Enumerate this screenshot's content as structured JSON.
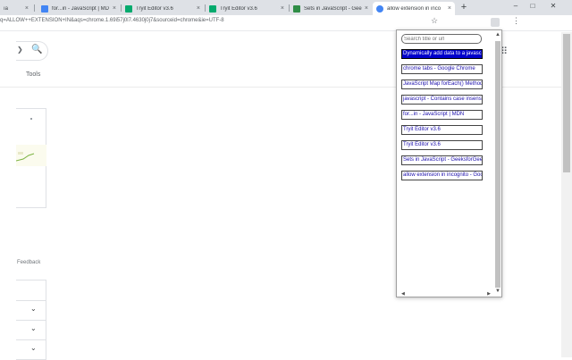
{
  "tabs": [
    {
      "title": "ıa",
      "active": false,
      "color": "#8ab4f8"
    },
    {
      "title": "for...in - JavaScript | MD",
      "active": false,
      "color": "#4285f4"
    },
    {
      "title": "Tryit Editor v3.6",
      "active": false,
      "color": "#04aa6d"
    },
    {
      "title": "Tryit Editor v3.6",
      "active": false,
      "color": "#04aa6d"
    },
    {
      "title": "Sets in JavaScript - Gee",
      "active": false,
      "color": "#2f8d46"
    },
    {
      "title": "allow extension in inco",
      "active": true,
      "color": "#4285f4"
    }
  ],
  "icons": {
    "close": "×",
    "new_tab": "+",
    "minimize": "–",
    "maximize": "□",
    "close_window": "✕",
    "star": "☆",
    "kebab": "⋮",
    "search": "🔍",
    "chevron_left": "❯",
    "chevron_down": "⌄",
    "apps": "⠿",
    "scroll_up": "▲",
    "scroll_down": "▼",
    "scroll_left": "◀",
    "scroll_right": "▶"
  },
  "address_bar": {
    "url": "q=ALLOW++EXTENSION+IN&aqs=chrome.1.69i57j0l7.4630j0j7&sourceid=chrome&ie=UTF-8"
  },
  "page": {
    "tools_label": "Tools",
    "feedback_label": "Feedback"
  },
  "popup": {
    "search_placeholder": "Search title or url",
    "items": [
      {
        "label": "Dynamically add data to a javascript",
        "selected": true
      },
      {
        "label": "chrome tabs - Google Chrome",
        "selected": false
      },
      {
        "label": "JavaScript Map forEach() Method",
        "selected": false
      },
      {
        "label": "javascript - Contains case insensitive",
        "selected": false
      },
      {
        "label": "for...in - JavaScript | MDN",
        "selected": false
      },
      {
        "label": "Tryit Editor v3.6",
        "selected": false
      },
      {
        "label": "Tryit Editor v3.6",
        "selected": false
      },
      {
        "label": "Sets in JavaScript - GeeksforGeeks",
        "selected": false
      },
      {
        "label": "allow extension in incognito - Google",
        "selected": false
      }
    ]
  },
  "colors": {
    "tabstrip": "#dee1e6",
    "selected_item": "#0000cc",
    "link": "#1a0dab"
  }
}
